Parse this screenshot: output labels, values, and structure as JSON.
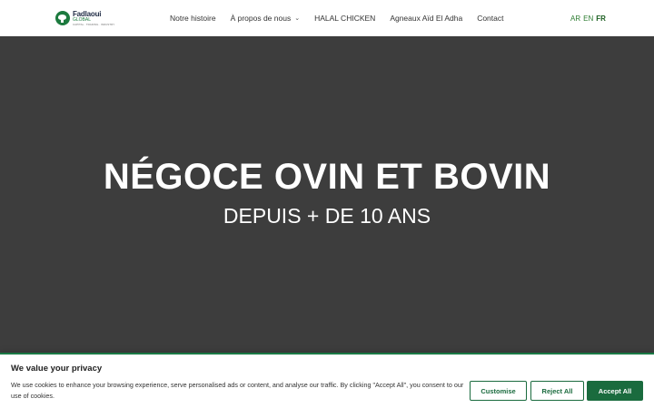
{
  "logo": {
    "name": "Fadlaoui",
    "sub": "GLOBAL",
    "tagline": "CAPITAL · TRADING · INDUSTRY"
  },
  "nav": {
    "items": [
      {
        "label": "Notre histoire"
      },
      {
        "label": "À propos de nous"
      },
      {
        "label": "HALAL CHICKEN"
      },
      {
        "label": "Agneaux Aïd El Adha"
      },
      {
        "label": "Contact"
      }
    ]
  },
  "languages": [
    "AR",
    "EN",
    "FR"
  ],
  "active_language": "FR",
  "hero": {
    "title": "NÉGOCE OVIN ET BOVIN",
    "subtitle": "DEPUIS + DE 10 ANS"
  },
  "cookie": {
    "title": "We value your privacy",
    "text": "We use cookies to enhance your browsing experience, serve personalised ads or content, and analyse our traffic. By clicking \"Accept All\", you consent to our use of cookies.",
    "customise": "Customise",
    "reject": "Reject All",
    "accept": "Accept All"
  },
  "colors": {
    "brand_green": "#1a6b3e",
    "hero_bg": "#3d3d3d"
  }
}
